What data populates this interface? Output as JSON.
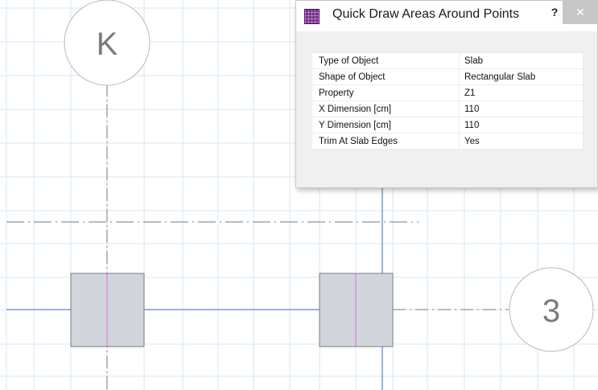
{
  "canvas": {
    "grid_bubble_K": "K",
    "grid_bubble_3": "3"
  },
  "dialog": {
    "title": "Quick Draw Areas Around Points",
    "help_label": "?",
    "close_label": "✕",
    "icon": "app-grid-icon",
    "rows": [
      {
        "key": "Type of Object",
        "value": "Slab"
      },
      {
        "key": "Shape of Object",
        "value": "Rectangular Slab"
      },
      {
        "key": "Property",
        "value": "Z1"
      },
      {
        "key": "X Dimension  [cm]",
        "value": "110"
      },
      {
        "key": "Y Dimension  [cm]",
        "value": "110"
      },
      {
        "key": "Trim At Slab Edges",
        "value": "Yes"
      }
    ]
  },
  "colors": {
    "grid_minor": "#d6e7f7",
    "grid_axis_blue": "#3b63c4",
    "slab_fill": "#d3d5dc",
    "slab_edge": "#777a80",
    "column_magenta": "#e36ae0"
  }
}
